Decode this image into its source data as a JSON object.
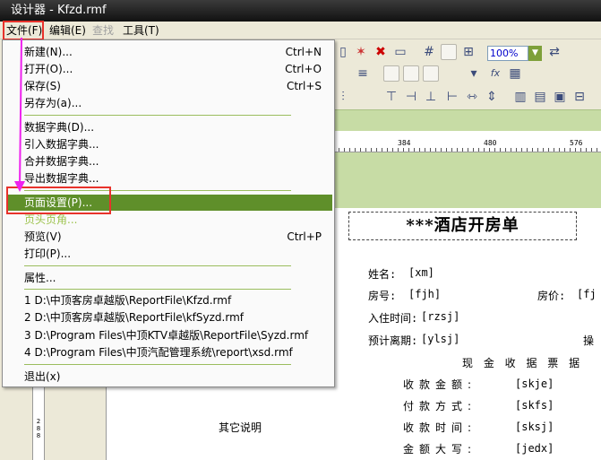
{
  "window": {
    "title": "设计器 - Kfzd.rmf"
  },
  "menubar": {
    "file": "文件(F)",
    "edit": "编辑(E)",
    "find": "查找",
    "tools": "工具(T)"
  },
  "file_menu": {
    "new": "新建(N)...",
    "new_sc": "Ctrl+N",
    "open": "打开(O)...",
    "open_sc": "Ctrl+O",
    "save": "保存(S)",
    "save_sc": "Ctrl+S",
    "save_as": "另存为(a)...",
    "dict": "数据字典(D)...",
    "import_dict": "引入数据字典...",
    "merge_dict": "合并数据字典...",
    "export_dict": "导出数据字典...",
    "page_setup": "页面设置(P)...",
    "header_footer": "页头页角...",
    "preview": "预览(V)",
    "preview_sc": "Ctrl+P",
    "print": "打印(P)...",
    "properties": "属性...",
    "recent1": "1 D:\\中顶客房卓越版\\ReportFile\\Kfzd.rmf",
    "recent2": "2 D:\\中顶客房卓越版\\ReportFile\\kfSyzd.rmf",
    "recent3": "3 D:\\Program Files\\中顶KTV卓越版\\ReportFile\\Syzd.rmf",
    "recent4": "4 D:\\Program Files\\中顶汽配管理系统\\report\\xsd.rmf",
    "exit": "退出(x)"
  },
  "toolbar": {
    "zoom": "100%",
    "fx": "fx"
  },
  "ruler": {
    "t1": "384",
    "t2": "480",
    "t3": "576"
  },
  "report": {
    "title": "***酒店开房单",
    "name_label": "姓名:",
    "name_field": "[xm]",
    "room_label": "房号:",
    "room_field": "[fjh]",
    "price_label": "房价:",
    "price_field": "[fj",
    "checkin_label": "入住时间:",
    "checkin_field": "[rzsj]",
    "leave_label": "预计离期:",
    "leave_field": "[ylsj]",
    "operator_label": "操",
    "receipt_title": "现 金 收 据 票 据",
    "amount_label": "收款金额:",
    "amount_field": "[skje]",
    "pay_label": "付款方式:",
    "pay_field": "[skfs]",
    "time_label": "收款时间:",
    "time_field": "[sksj]",
    "upper_label": "金额大写:",
    "upper_field": "[jedx]",
    "other_note": "其它说明"
  },
  "vruler": {
    "l1": "2",
    "l2": "8",
    "l3": "8"
  }
}
